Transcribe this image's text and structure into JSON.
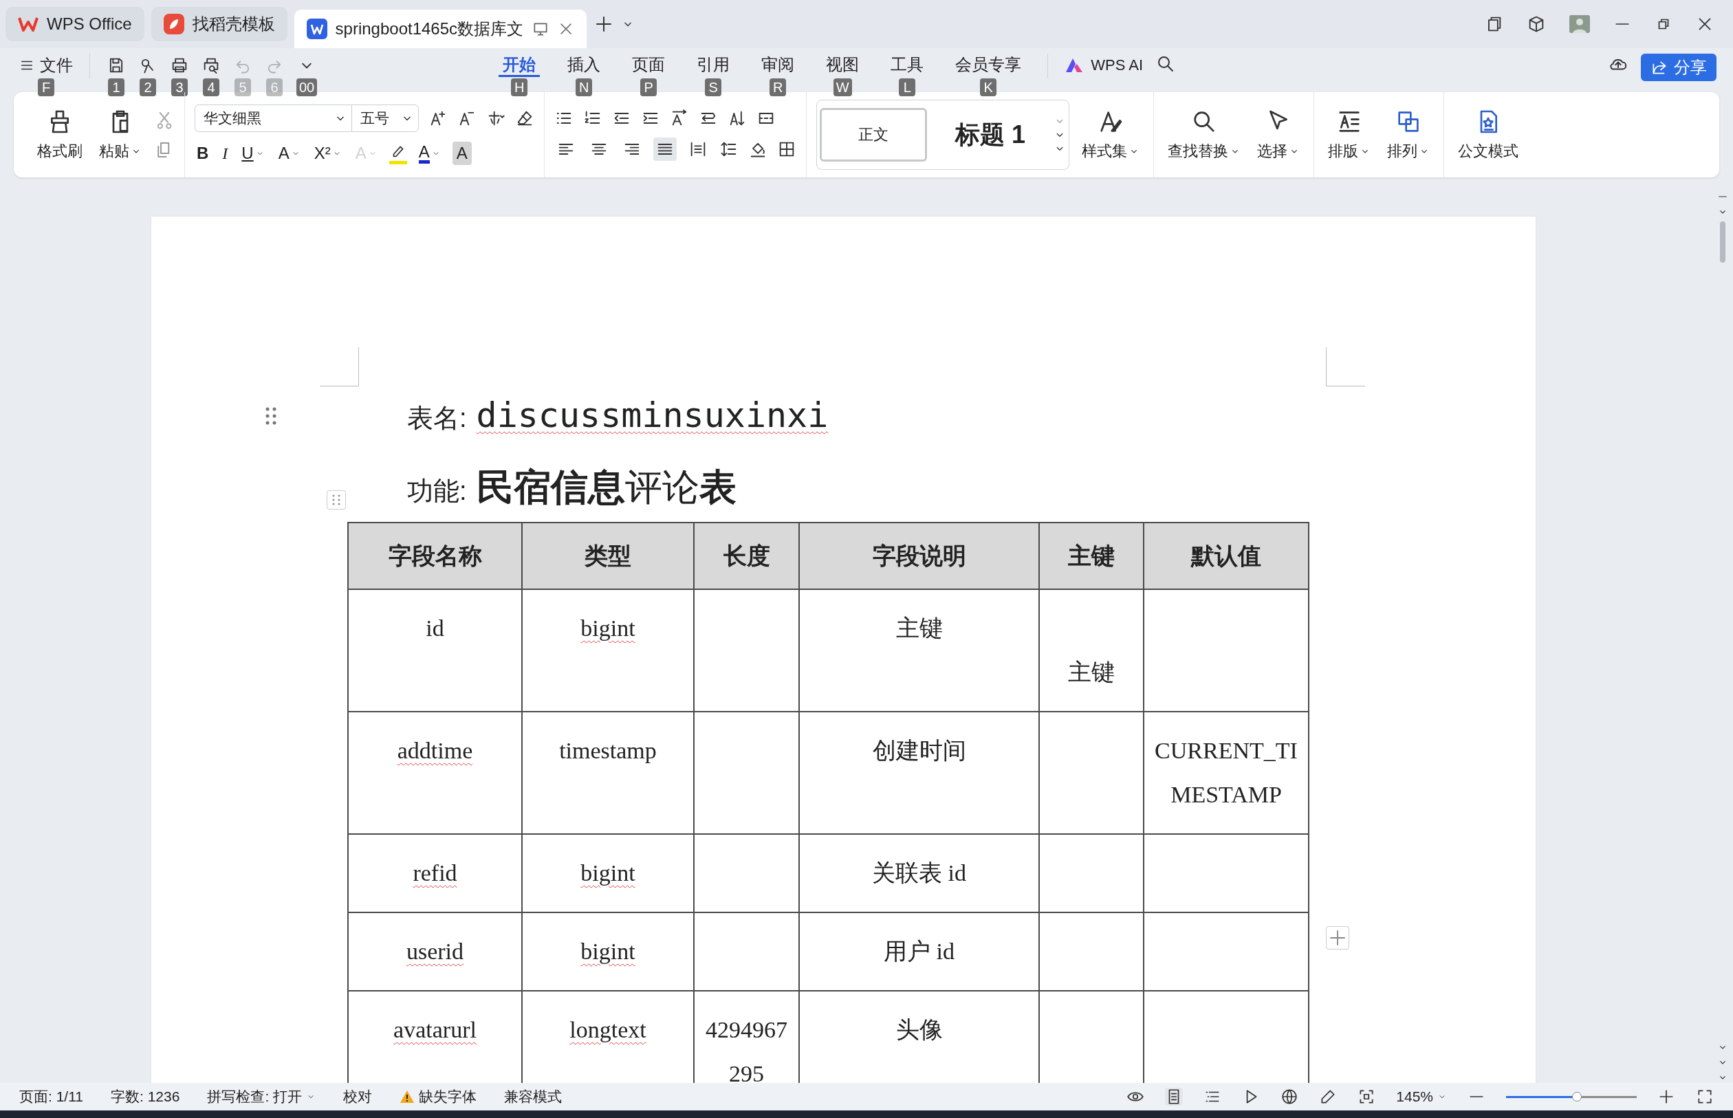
{
  "tabs": [
    {
      "label": "WPS Office",
      "kind": "home",
      "selected": false
    },
    {
      "label": "找稻壳模板",
      "kind": "template",
      "selected": false
    },
    {
      "label": "springboot1465c数据库文",
      "kind": "doc",
      "selected": true
    }
  ],
  "menu": {
    "file": {
      "label": "文件",
      "key": "F"
    },
    "quick": [
      {
        "key": "1",
        "kind": "save",
        "disabled": false
      },
      {
        "key": "2",
        "kind": "loop",
        "disabled": false
      },
      {
        "key": "3",
        "kind": "print",
        "disabled": false
      },
      {
        "key": "4",
        "kind": "preview",
        "disabled": false
      },
      {
        "key": "5",
        "kind": "undo",
        "disabled": true
      },
      {
        "key": "6",
        "kind": "redo",
        "disabled": true
      },
      {
        "key": "00",
        "kind": "more",
        "disabled": false
      }
    ],
    "ribbon_tabs": [
      {
        "label": "开始",
        "key": "H",
        "selected": true
      },
      {
        "label": "插入",
        "key": "N",
        "selected": false
      },
      {
        "label": "页面",
        "key": "P",
        "selected": false
      },
      {
        "label": "引用",
        "key": "S",
        "selected": false
      },
      {
        "label": "审阅",
        "key": "R",
        "selected": false
      },
      {
        "label": "视图",
        "key": "W",
        "selected": false
      },
      {
        "label": "工具",
        "key": "L",
        "selected": false
      },
      {
        "label": "会员专享",
        "key": "K",
        "selected": false
      }
    ],
    "ai": "WPS AI",
    "share": "分享"
  },
  "ribbon": {
    "format_painter": "格式刷",
    "paste": "粘贴",
    "font_name": "华文细黑",
    "font_size": "五号",
    "font_buttons": [
      {
        "label": "B",
        "kind": "bold",
        "disabled": false
      },
      {
        "label": "I",
        "kind": "italic",
        "disabled": false
      },
      {
        "label": "U",
        "kind": "underline",
        "disabled": false
      },
      {
        "label": "A",
        "kind": "strike",
        "disabled": false
      },
      {
        "label": "X²",
        "kind": "super",
        "disabled": false
      },
      {
        "label": "A",
        "kind": "effect",
        "disabled": true
      },
      {
        "label": "A",
        "kind": "color",
        "disabled": false
      },
      {
        "label": "A",
        "kind": "shade",
        "disabled": false
      }
    ],
    "alignment": [
      {
        "selected": false
      },
      {
        "selected": false
      },
      {
        "selected": false
      },
      {
        "selected": true
      },
      {
        "selected": false
      }
    ],
    "styles": [
      {
        "label": "正文",
        "selected": true
      },
      {
        "label": "标题 1",
        "selected": false
      }
    ],
    "style_set": "样式集",
    "find": "查找替换",
    "select": "选择",
    "layout": "排版",
    "arrange": "排列",
    "official": "公文模式"
  },
  "document": {
    "table_name": {
      "label": "表名:",
      "value": "discussminsuxinxi",
      "flagged": true
    },
    "function": {
      "label": "功能:",
      "value": "**民宿信息**评论**表**"
    },
    "table": {
      "columns": [
        "字段名称",
        "类型",
        "长度",
        "字段说明",
        "主键",
        "默认值"
      ],
      "rows": [
        [
          {
            "text": "id",
            "flagged": false
          },
          {
            "text": "bigint",
            "flagged": true
          },
          null,
          {
            "text": "主键",
            "flagged": false
          },
          {
            "text": "主键",
            "flagged": false
          },
          null
        ],
        [
          {
            "text": "addtime",
            "flagged": true
          },
          {
            "text": "timestamp",
            "flagged": false
          },
          null,
          {
            "text": "创建时间",
            "flagged": false
          },
          null,
          {
            "text": "CURRENT_TIMESTAMP",
            "flagged": false
          }
        ],
        [
          {
            "text": "refid",
            "flagged": true
          },
          {
            "text": "bigint",
            "flagged": true
          },
          null,
          {
            "text": "关联表 id",
            "flagged": false
          },
          null,
          null
        ],
        [
          {
            "text": "userid",
            "flagged": true
          },
          {
            "text": "bigint",
            "flagged": true
          },
          null,
          {
            "text": "用户 id",
            "flagged": false
          },
          null,
          null
        ],
        [
          {
            "text": "avatarurl",
            "flagged": true
          },
          {
            "text": "longtext",
            "flagged": true
          },
          {
            "text": "4294967295",
            "flagged": false
          },
          {
            "text": "头像",
            "flagged": false
          },
          null,
          null
        ]
      ]
    }
  },
  "status_bar": {
    "page": "页面: 1/11",
    "words": "字数: 1236",
    "spell": "拼写检查: 打开",
    "proofread": "校对",
    "missing_font": "缺失字体",
    "compat": "兼容模式",
    "zoom": "145%",
    "zoom_slider": {
      "level": 0.54
    }
  }
}
